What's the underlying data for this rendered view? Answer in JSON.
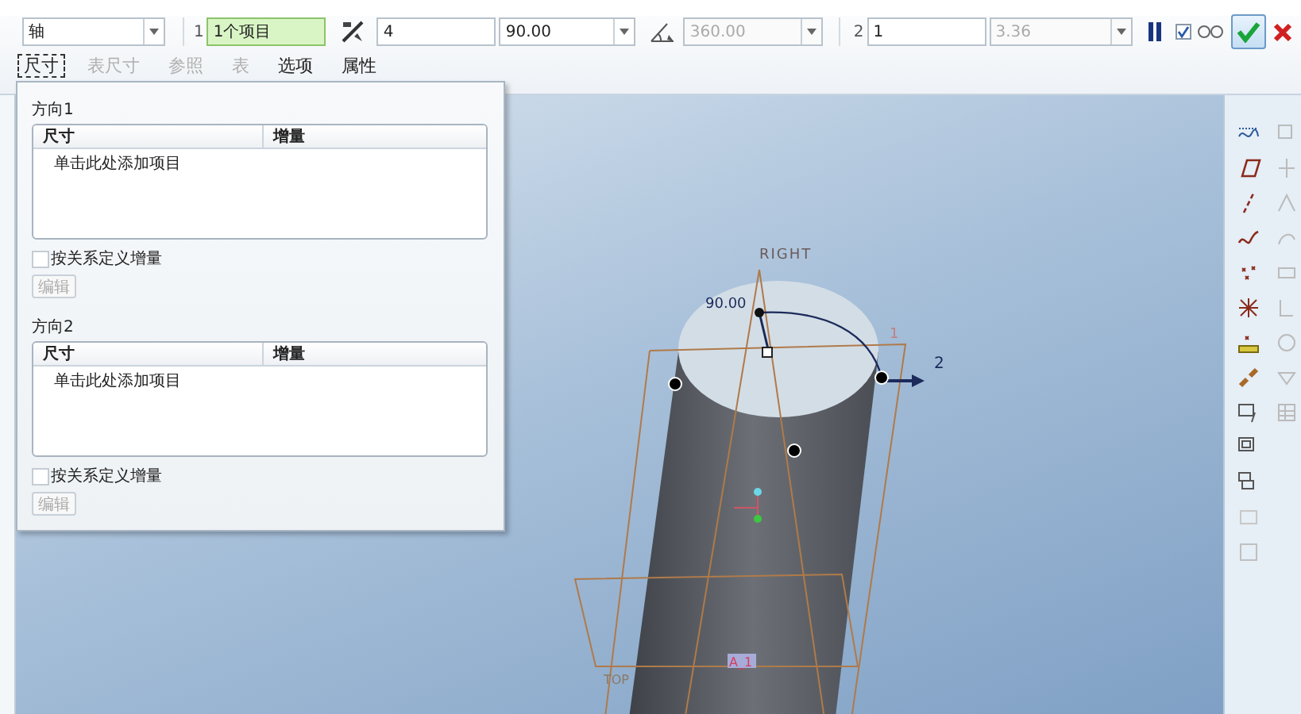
{
  "toolbar": {
    "reference_type": "轴",
    "direction1": {
      "index": "1",
      "collector": "1个项目",
      "count": "4",
      "spacing": "90.00",
      "extent": "360.00",
      "extent_disabled": true
    },
    "direction2": {
      "index": "2",
      "count": "1",
      "spacing": "3.36",
      "spacing_disabled": true
    },
    "preview_checked": true
  },
  "tabs": [
    {
      "label": "尺寸",
      "selected": true,
      "disabled": false
    },
    {
      "label": "表尺寸",
      "selected": false,
      "disabled": true
    },
    {
      "label": "参照",
      "selected": false,
      "disabled": true
    },
    {
      "label": "表",
      "selected": false,
      "disabled": true
    },
    {
      "label": "选项",
      "selected": false,
      "disabled": false
    },
    {
      "label": "属性",
      "selected": false,
      "disabled": false
    }
  ],
  "panel": {
    "sections": [
      {
        "title": "方向1",
        "columns": [
          "尺寸",
          "增量"
        ],
        "add_row": "单击此处添加项目",
        "relation_label": "按关系定义增量",
        "relation_checked": false,
        "edit_button": "编辑",
        "edit_disabled": true
      },
      {
        "title": "方向2",
        "columns": [
          "尺寸",
          "增量"
        ],
        "add_row": "单击此处添加项目",
        "relation_label": "按关系定义增量",
        "relation_checked": false,
        "edit_button": "编辑",
        "edit_disabled": true
      }
    ]
  },
  "viewport": {
    "plane_right": "RIGHT",
    "angle_value": "90.00",
    "direction_1": "1",
    "direction_2": "2",
    "plane_top": "TOP",
    "axis_label": "A_1"
  }
}
